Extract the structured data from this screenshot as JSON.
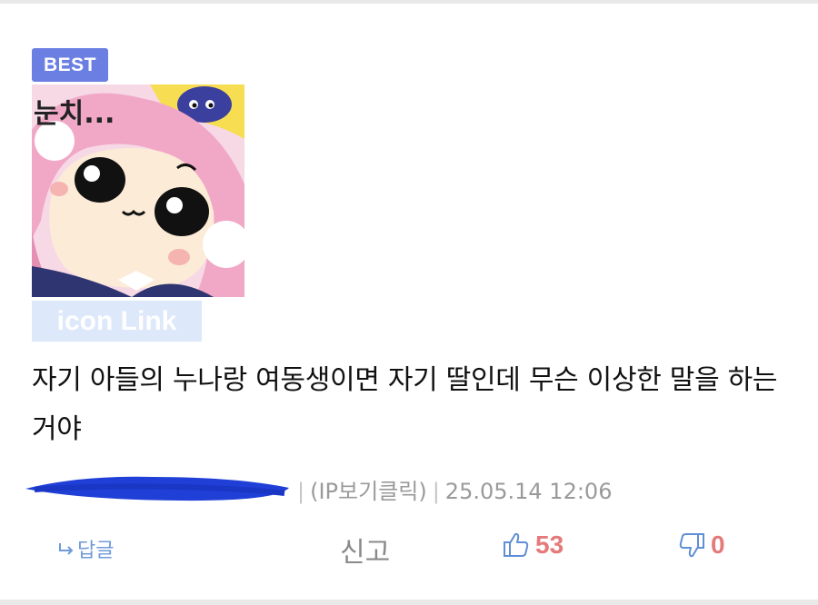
{
  "badge": {
    "label": "BEST"
  },
  "avatar": {
    "caption": "눈치..."
  },
  "icon_link": {
    "label": "icon Link"
  },
  "comment": {
    "text": "자기 아들의 누나랑 여동생이면 자기 딸인데 무슨 이상한 말을 하는 거야"
  },
  "meta": {
    "ip_label": "(IP보기클릭)",
    "timestamp": "25.05.14 12:06"
  },
  "actions": {
    "reply_label": "답글",
    "report_label": "신고",
    "like_count": "53",
    "dislike_count": "0"
  },
  "colors": {
    "badge": "#6b7fe3",
    "icon_link_bg": "#dde8fb",
    "reply": "#6f9ad8",
    "thumb_icon": "#5f8fd6",
    "count": "#e57a7a",
    "redaction": "#1f3fd6"
  }
}
